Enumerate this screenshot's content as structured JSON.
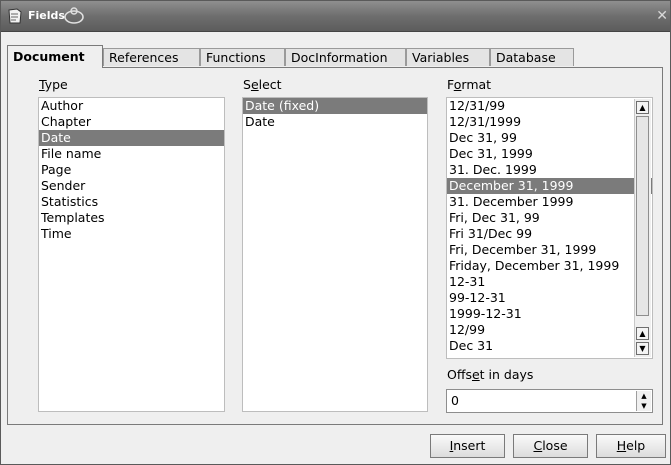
{
  "window": {
    "title": "Fields"
  },
  "tabs": [
    "Document",
    "References",
    "Functions",
    "DocInformation",
    "Variables",
    "Database"
  ],
  "type": {
    "label_ul": "T",
    "label_rest": "ype",
    "items": [
      "Author",
      "Chapter",
      "Date",
      "File name",
      "Page",
      "Sender",
      "Statistics",
      "Templates",
      "Time"
    ],
    "selected": "Date"
  },
  "select": {
    "label_pre": "S",
    "label_ul": "e",
    "label_rest": "lect",
    "items": [
      "Date (fixed)",
      "Date"
    ],
    "selected": "Date (fixed)"
  },
  "format": {
    "label_pre": "F",
    "label_ul": "o",
    "label_rest": "rmat",
    "items": [
      "12/31/99",
      "12/31/1999",
      "Dec 31, 99",
      "Dec 31, 1999",
      "31. Dec. 1999",
      "December 31, 1999",
      "31. December 1999",
      "Fri, Dec 31, 99",
      "Fri 31/Dec 99",
      "Fri, December 31, 1999",
      "Friday, December 31, 1999",
      "12-31",
      "99-12-31",
      "1999-12-31",
      "12/99",
      "Dec 31"
    ],
    "selected": "December 31, 1999"
  },
  "offset": {
    "label_pre": "Offs",
    "label_ul": "e",
    "label_rest": "t in days",
    "value": "0"
  },
  "buttons": {
    "insert": {
      "ul": "I",
      "rest": "nsert"
    },
    "close": {
      "ul": "C",
      "rest": "lose"
    },
    "help": {
      "ul": "H",
      "rest": "elp"
    }
  },
  "icons": {
    "app": "document-icon",
    "close": "close-icon"
  }
}
